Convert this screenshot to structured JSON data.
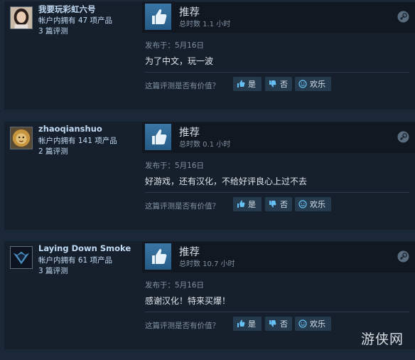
{
  "reviews": [
    {
      "persona_name": "我要玩彩虹六号",
      "products_owned": "帐户内拥有 47 项产品",
      "review_count": "3 篇评测",
      "recommendation": "推荐",
      "hours": "总时数 1.1 小时",
      "posted": "发布于：5月16日",
      "content": "为了中文，玩一波",
      "helpful_question": "这篇评测是否有价值？",
      "yes_label": "是",
      "no_label": "否",
      "funny_label": "欢乐",
      "avatar_icon": "user-photo-avatar"
    },
    {
      "persona_name": "zhaoqianshuo",
      "products_owned": "帐户内拥有 141 项产品",
      "review_count": "2 篇评测",
      "recommendation": "推荐",
      "hours": "总时数 0.1 小时",
      "posted": "发布于：5月16日",
      "content": "好游戏，还有汉化，不给好评良心上过不去",
      "helpful_question": "这篇评测是否有价值？",
      "yes_label": "是",
      "no_label": "否",
      "funny_label": "欢乐",
      "avatar_icon": "lion-avatar"
    },
    {
      "persona_name": "Laying Down Smoke",
      "products_owned": "帐户内拥有 61 项产品",
      "review_count": "3 篇评测",
      "recommendation": "推荐",
      "hours": "总时数 10.7 小时",
      "posted": "发布于：5月16日",
      "content": "感谢汉化！特来买爆！",
      "helpful_question": "这篇评测是否有价值？",
      "yes_label": "是",
      "no_label": "否",
      "funny_label": "欢乐",
      "avatar_icon": "dark-emblem-avatar"
    }
  ],
  "watermark": "游侠网",
  "colors": {
    "background": "#1b2838",
    "card": "#16202d",
    "accent": "#66c0f4",
    "thumb": "#3a77a6",
    "button": "#263a4d"
  }
}
